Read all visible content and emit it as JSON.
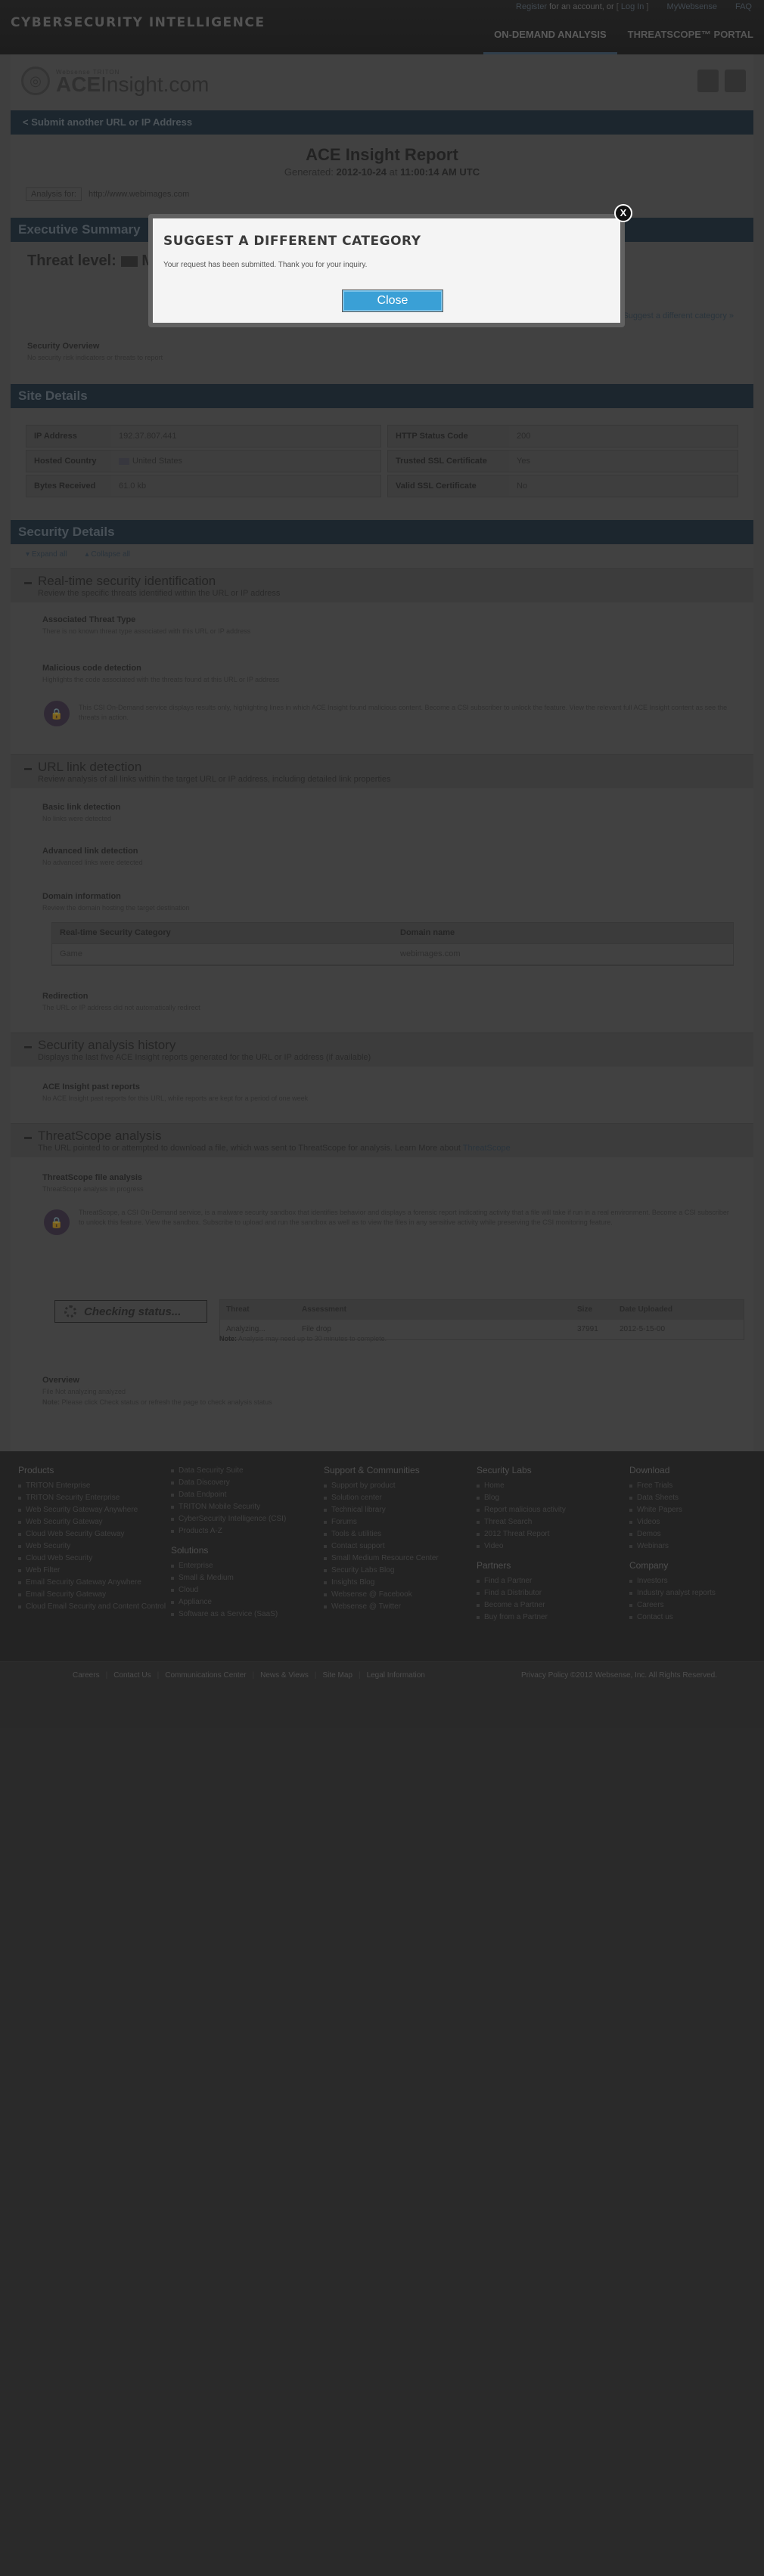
{
  "topbar": {
    "brand": "CYBERSECURITY INTELLIGENCE",
    "util": {
      "register": "Register",
      "for_account": "for an account, or",
      "login": "Log In",
      "mywebsense": "MyWebsense",
      "faq": "FAQ"
    },
    "nav": [
      "ON-DEMAND ANALYSIS",
      "THREATSCOPE™ PORTAL"
    ]
  },
  "header": {
    "logo_small": "Websense TRITON",
    "logo_main": "ACE",
    "logo_main2": "Insight.com"
  },
  "submit_bar": "< Submit another URL or IP Address",
  "report": {
    "title": "ACE Insight Report",
    "generated_prefix": "Generated:",
    "generated_date": "2012-10-24",
    "generated_at": "at",
    "generated_time": "11:00:14 AM UTC",
    "analysis_for_label": "Analysis for:",
    "analysis_for_value": "http://www.webimages.com"
  },
  "exec": {
    "bar": "Executive Summary",
    "threat_level": "Threat level:",
    "threat_value": "M",
    "suggest_link": "Suggest a different category »",
    "overview_title": "Security Overview",
    "overview_sub": "No security risk indicators or threats to report"
  },
  "site": {
    "bar": "Site Details",
    "left": [
      {
        "k": "IP Address",
        "v": "192.37.807.441"
      },
      {
        "k": "Hosted Country",
        "v": "United States"
      },
      {
        "k": "Bytes Received",
        "v": "61.0 kb"
      }
    ],
    "right": [
      {
        "k": "HTTP Status Code",
        "v": "200"
      },
      {
        "k": "Trusted SSL Certificate",
        "v": "Yes"
      },
      {
        "k": "Valid SSL Certificate",
        "v": "No"
      }
    ]
  },
  "details": {
    "bar": "Security Details",
    "expand": "Expand all",
    "collapse": "Collapse all",
    "rt": {
      "title": "Real-time security identification",
      "sub": "Review the specific threats identified within the URL or IP address",
      "i1": "Associated Threat Type",
      "i1s": "There is no known threat type associated with this URL or IP address",
      "i2": "Malicious code detection",
      "i2s": "Highlights the code associated with the threats found at this URL or IP address",
      "lock_text": "This CSI On-Demand service displays results only, highlighting lines in which ACE Insight found malicious content. Become a CSI subscriber to unlock the feature. View the relevant full ACE Insight content as see the threats in action."
    },
    "url": {
      "title": "URL link detection",
      "sub": "Review analysis of all links within the target URL or IP address, including detailed link properties",
      "i1": "Basic link detection",
      "i1s": "No links were detected",
      "i2": "Advanced link detection",
      "i2s": "No advanced links were detected",
      "i3": "Domain information",
      "i3s": "Review the domain hosting the target destination",
      "th1": "Real-time Security Category",
      "th2": "Domain name",
      "td1": "Game",
      "td2": "webimages.com",
      "i4": "Redirection",
      "i4s": "The URL or IP address did not automatically redirect"
    },
    "hist": {
      "title": "Security analysis history",
      "sub": "Displays the last five ACE Insight reports generated for the URL or IP address (if available)",
      "i1": "ACE Insight past reports",
      "i1s": "No ACE Insight past reports for this URL, while reports are kept for a period of one week"
    },
    "ts": {
      "title": "ThreatScope analysis",
      "sub": "The URL pointed to or attempted to download a file, which was sent to ThreatScope for analysis. Learn More about",
      "sub_link": "ThreatScope",
      "i1": "ThreatScope file analysis",
      "i1s": "ThreatScope analysis in progress",
      "lock_text": "ThreatScope, a CSI On-Demand service, is a malware security sandbox that identifies behavior and displays a forensic report indicating activity that a file will take if run in a real environment. Become a CSI subscriber to unlock this feature. View the sandbox. Subscribe to upload and run the sandbox as well as to view the files in any sensitive activity while preserving the CSI monitoring feature.",
      "checking": "Checking status...",
      "th": [
        "Threat",
        "Assessment",
        "Size",
        "Date Uploaded"
      ],
      "td": [
        "Analyzing...",
        "File drop",
        "37991",
        "2012-5-15-00"
      ],
      "note_label": "Note:",
      "note": "Analysis may need up to 30 minutes to complete.",
      "ov_title": "Overview",
      "ov_sub": "File Not analyzing analyzed",
      "ov_note_label": "Note:",
      "ov_note": "Please click Check status or refresh the page to check analysis status"
    }
  },
  "footer": {
    "cols": [
      {
        "heading": "Products",
        "items": [
          "TRITON Enterprise",
          "TRITON Security Enterprise",
          "Web Security Gateway Anywhere",
          "Web Security Gateway",
          "Cloud Web Security Gateway",
          "Web Security",
          "Cloud Web Security",
          "Web Filter",
          "Email Security Gateway Anywhere",
          "Email Security Gateway",
          "Cloud Email Security and Content Control"
        ]
      },
      {
        "heading": "",
        "items": [
          "Data Security Suite",
          "Data Discovery",
          "Data Endpoint",
          "TRITON Mobile Security",
          "CyberSecurity Intelligence (CSI)",
          "Products A-Z"
        ],
        "heading2": "Solutions",
        "items2": [
          "Enterprise",
          "Small & Medium",
          "Cloud",
          "Appliance",
          "Software as a Service (SaaS)"
        ]
      },
      {
        "heading": "Support & Communities",
        "items": [
          "Support by product",
          "Solution center",
          "Technical library",
          "Forums",
          "Tools & utilities",
          "Contact support",
          "Small Medium Resource Center",
          "Security Labs Blog",
          "Insights Blog",
          "Websense @ Facebook",
          "Websense @ Twitter"
        ]
      },
      {
        "heading": "Security Labs",
        "items": [
          "Home",
          "Blog",
          "Report malicious activity",
          "Threat Search",
          "2012 Threat Report",
          "Video"
        ],
        "heading2": "Partners",
        "items2": [
          "Find a Partner",
          "Find a Distributor",
          "Become a Partner",
          "Buy from a Partner"
        ]
      },
      {
        "heading": "Download",
        "items": [
          "Free Trials",
          "Data Sheets",
          "White Papers",
          "Videos",
          "Demos",
          "Webinars"
        ],
        "heading2": "Company",
        "items2": [
          "Investors",
          "Industry analyst reports",
          "Careers",
          "Contact us"
        ]
      }
    ],
    "bottom": [
      "Careers",
      "Contact Us",
      "Communications Center",
      "News & Views",
      "Site Map",
      "Legal Information"
    ],
    "copyright": "Privacy Policy ©2012 Websense, Inc. All Rights Reserved."
  },
  "modal": {
    "title": "SUGGEST A DIFFERENT CATEGORY",
    "message": "Your request has been submitted. Thank you for your inquiry.",
    "close_label": "Close",
    "x_label": "X"
  }
}
